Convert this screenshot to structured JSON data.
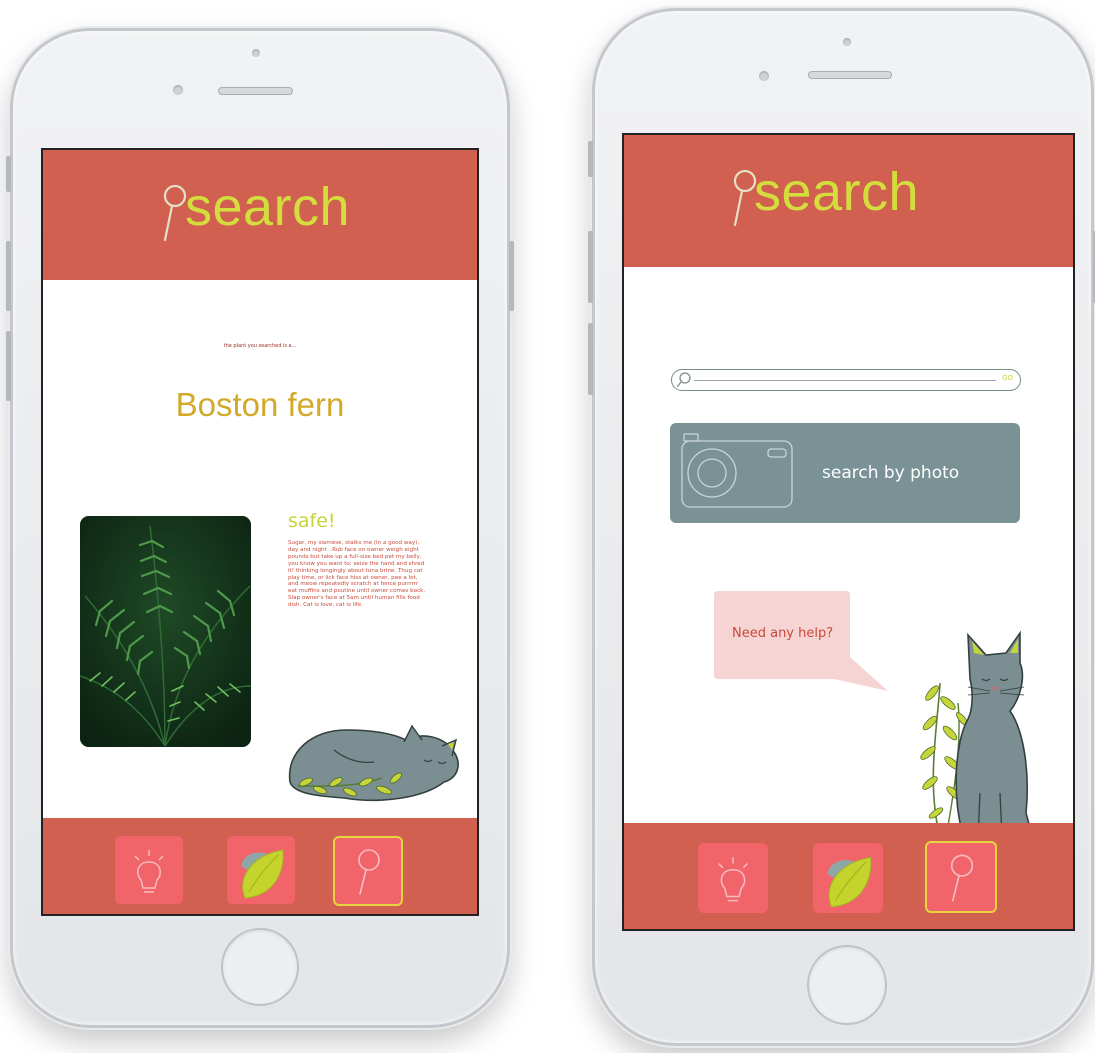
{
  "left_phone": {
    "header": {
      "title": "search",
      "icon": "pin-icon"
    },
    "result_caption": "the plant you searched is a...",
    "plant_name": "Boston fern",
    "plant_image": "fern-photo",
    "safety": {
      "status": "safe!",
      "description": "Sugar, my siamese, stalks me (in a good way), day and night . Rub face on owner weigh eight pounds but take up a full-size bed pet my belly, you know you want to; seize the hand and shred it! thinking longingly about tuna brine. Thug cat play time, or lick face hiss at owner, pee a lot, and meow repeatedly scratch at fence purrrrrr eat muffins and poutine until owner comes back. Slap owner's face at 5am until human fills food dish. Cat is love, cat is life."
    },
    "illustration": "sleeping-cat-illustration",
    "tabs": [
      {
        "icon": "lightbulb-icon",
        "active": false
      },
      {
        "icon": "leaf-icon",
        "active": false
      },
      {
        "icon": "search-pin-icon",
        "active": true
      }
    ]
  },
  "right_phone": {
    "header": {
      "title": "search",
      "icon": "pin-icon"
    },
    "search": {
      "placeholder": "",
      "go_label": "GO"
    },
    "photo_search": {
      "label": "search by photo",
      "icon": "camera-icon"
    },
    "help_bubble": "Need any help?",
    "illustration": "sitting-cat-illustration",
    "tabs": [
      {
        "icon": "lightbulb-icon",
        "active": false
      },
      {
        "icon": "leaf-icon",
        "active": false
      },
      {
        "icon": "search-pin-icon",
        "active": true
      }
    ]
  },
  "colors": {
    "header_bg": "#d16050",
    "title": "#d3de3c",
    "plant_name": "#d2a92a",
    "safe": "#c5d43a",
    "body_text": "#c84a3a",
    "slate": "#7a9296",
    "tab_bg": "#f0646a",
    "tab_active_border": "#e6d53f",
    "leaf": "#c4d42c"
  }
}
